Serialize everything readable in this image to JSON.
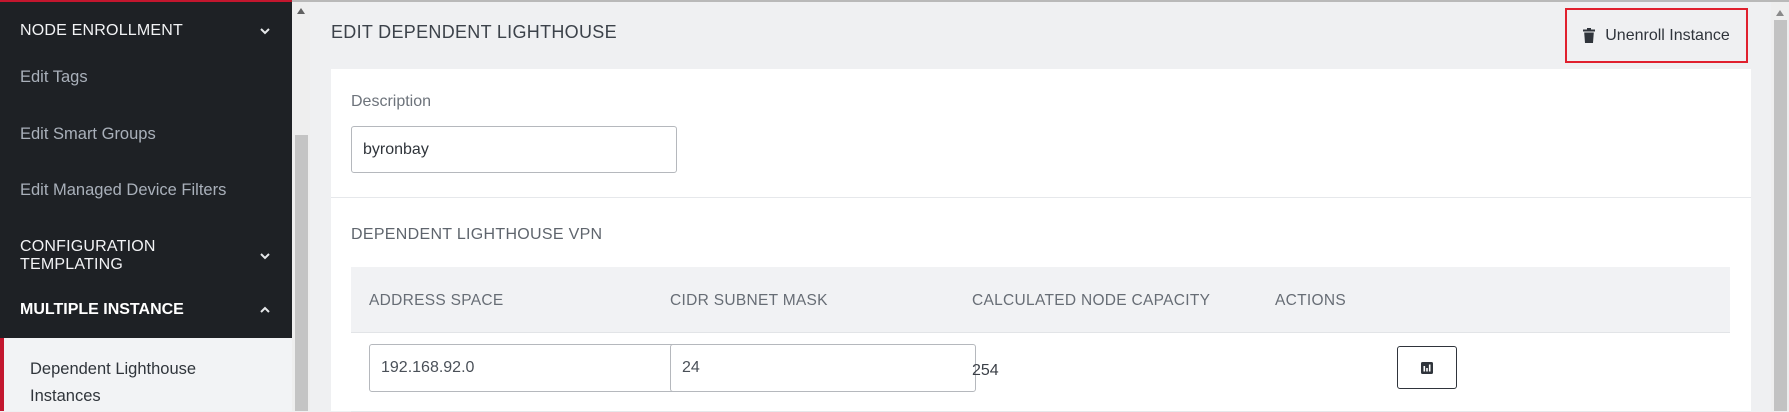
{
  "sidebar": {
    "items": [
      {
        "label": "NODE ENROLLMENT",
        "type": "section",
        "expanded": false
      },
      {
        "label": "Edit Tags",
        "type": "link"
      },
      {
        "label": "Edit Smart Groups",
        "type": "link"
      },
      {
        "label": "Edit Managed Device Filters",
        "type": "link"
      },
      {
        "label": "CONFIGURATION TEMPLATING",
        "type": "section",
        "expanded": false
      },
      {
        "label": "MULTIPLE INSTANCE",
        "type": "section",
        "expanded": true
      }
    ],
    "active_subitem": "Dependent Lighthouse Instances"
  },
  "header": {
    "title": "EDIT DEPENDENT LIGHTHOUSE",
    "unenroll_label": "Unenroll Instance",
    "unenroll_icon": "trash-icon"
  },
  "form": {
    "description_label": "Description",
    "description_value": "byronbay"
  },
  "vpn": {
    "title": "DEPENDENT LIGHTHOUSE VPN",
    "columns": [
      "ADDRESS SPACE",
      "CIDR SUBNET MASK",
      "CALCULATED NODE CAPACITY",
      "ACTIONS"
    ],
    "rows": [
      {
        "address_space": "192.168.92.0",
        "cidr_mask": "24",
        "capacity": "254",
        "action_icon": "chart-icon"
      }
    ]
  },
  "colors": {
    "accent": "#c3162e",
    "highlight_border": "#e0202e",
    "sidebar_bg": "#1e2125"
  }
}
